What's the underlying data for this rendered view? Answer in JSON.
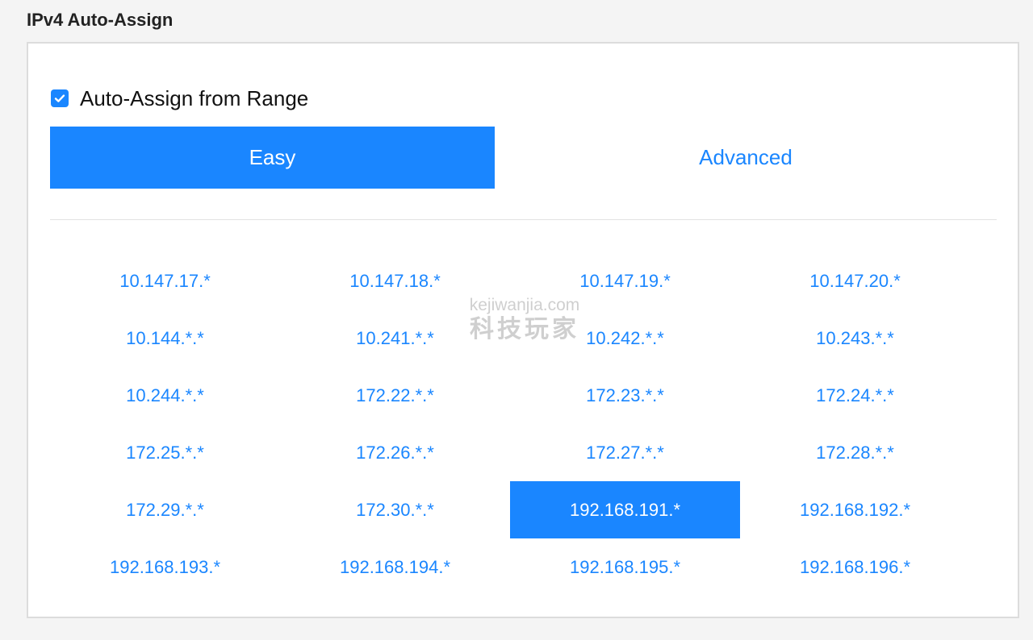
{
  "section": {
    "title": "IPv4 Auto-Assign"
  },
  "auto_assign": {
    "label": "Auto-Assign from Range",
    "checked": true
  },
  "tabs": [
    {
      "label": "Easy",
      "active": true
    },
    {
      "label": "Advanced",
      "active": false
    }
  ],
  "ranges": [
    "10.147.17.*",
    "10.147.18.*",
    "10.147.19.*",
    "10.147.20.*",
    "10.144.*.*",
    "10.241.*.*",
    "10.242.*.*",
    "10.243.*.*",
    "10.244.*.*",
    "172.22.*.*",
    "172.23.*.*",
    "172.24.*.*",
    "172.25.*.*",
    "172.26.*.*",
    "172.27.*.*",
    "172.28.*.*",
    "172.29.*.*",
    "172.30.*.*",
    "192.168.191.*",
    "192.168.192.*",
    "192.168.193.*",
    "192.168.194.*",
    "192.168.195.*",
    "192.168.196.*"
  ],
  "selected_range": "192.168.191.*",
  "watermark": {
    "url": "kejiwanjia.com",
    "text": "科技玩家"
  },
  "colors": {
    "accent": "#1a86ff",
    "background": "#f4f4f4",
    "panel": "#ffffff",
    "border": "#dcdcdc"
  },
  "icons": {
    "checkbox": "check-icon"
  }
}
